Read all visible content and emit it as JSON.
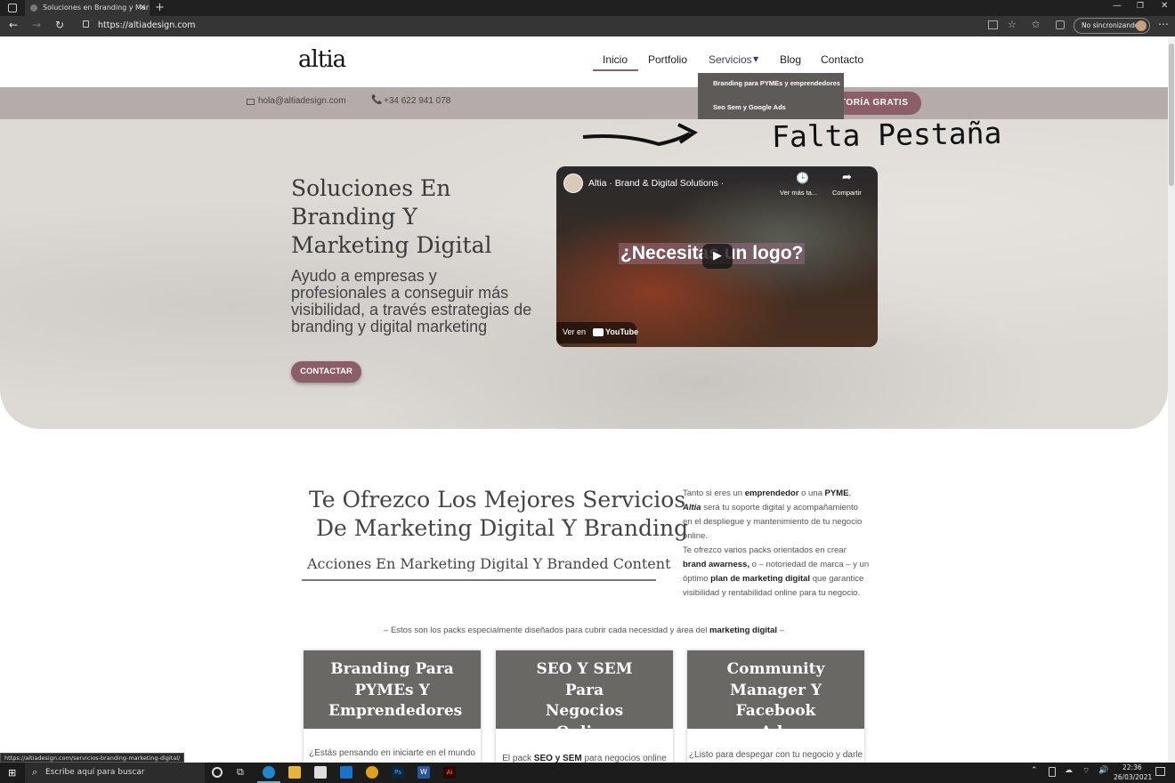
{
  "browser": {
    "tab_title": "Soluciones en Branding y Marke",
    "url": "https://altiadesign.com",
    "sync_label": "No sincronizando",
    "status_url": "https://altiadesign.com/servicios-branding-marketing-digital/"
  },
  "site": {
    "logo": "altia",
    "nav": [
      "Inicio",
      "Portfolio",
      "Servicios",
      "Blog",
      "Contacto"
    ],
    "dropdown": [
      "Branding para PYMEs y emprendedores",
      "Seo Sem y Google Ads"
    ],
    "email": "hola@altiadesign.com",
    "phone": "+34 622 941 078",
    "cta_top": "TORÍA GRATIS"
  },
  "annotation": "Falta Pestaña",
  "hero": {
    "title": "Soluciones En Branding Y Marketing Digital",
    "subtitle": "Ayudo a empresas y profesionales a conseguir más visibilidad, a través estrategias de branding y digital marketing",
    "button": "CONTACTAR"
  },
  "video": {
    "channel_title": "Altia · Brand & Digital Solutions ·",
    "watch_later": "Ver más ta...",
    "share": "Compartir",
    "overlay_text": "¿Necesitas un logo?",
    "watch_on": "Ver en",
    "youtube": "YouTube"
  },
  "services": {
    "heading_line1": "Te Ofrezco Los Mejores Servicios",
    "heading_line2": "De Marketing Digital Y Branding",
    "subheading": "Acciones En Marketing Digital Y Branded Content",
    "p1_a": "Tanto si eres un ",
    "p1_b": "emprendedor",
    "p1_c": " o una ",
    "p1_d": "PYME",
    "p1_e": ", ",
    "p1_f": "Altia",
    "p1_g": " será tu soporte digital y acompañamiento en el despliegue y mantenimiento de tu negocio online.",
    "p2_a": "Te ofrezco varios packs orientados en crear ",
    "p2_b": "brand awarness,",
    "p2_c": " o – notoriedad de marca – y un óptimo ",
    "p2_d": "plan de marketing digital",
    "p2_e": " que garantice visibilidad y rentabilidad online para tu negocio.",
    "packs_intro_a": "– Estos son los packs especialmente diseñados para cubrir cada necesidad y área del ",
    "packs_intro_b": "marketing digital",
    "packs_intro_c": " –"
  },
  "packs": [
    {
      "title": "Branding Para PYMEs Y Emprendedores",
      "text": "¿Estás pensando en iniciarte en el mundo"
    },
    {
      "title": "SEO Y SEM Para Negocios Online",
      "text_a": "El pack ",
      "text_b": "SEO y SEM",
      "text_c": " para negocios online"
    },
    {
      "title": "Community Manager Y Facebook Ads",
      "text": "¿Listo para despegar con tu negocio y darle"
    }
  ],
  "taskbar": {
    "search_placeholder": "Escribe aquí para buscar",
    "time": "22:36",
    "date": "26/03/2021"
  }
}
